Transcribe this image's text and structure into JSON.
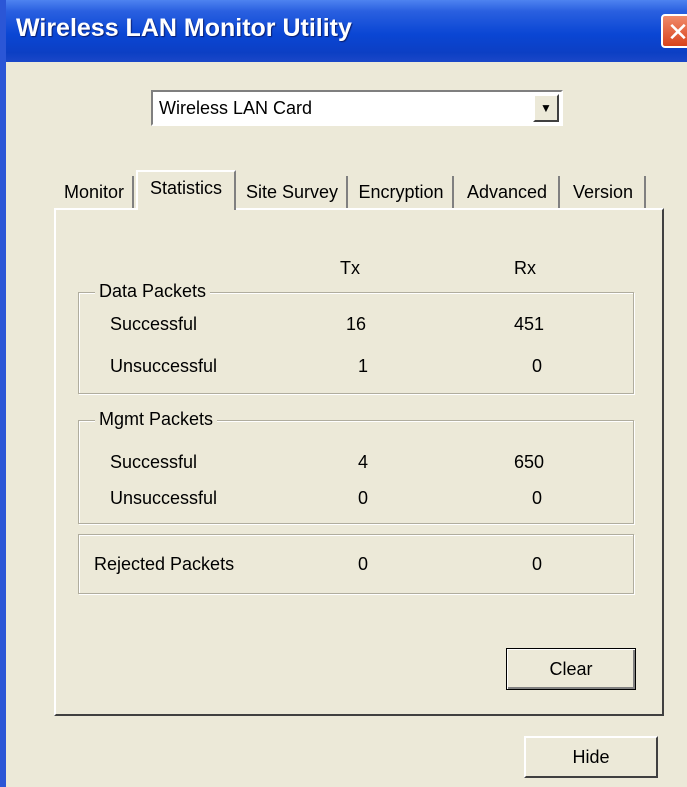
{
  "window": {
    "title": "Wireless LAN Monitor Utility",
    "close_glyph": "✕"
  },
  "card_select": {
    "value": "Wireless LAN Card",
    "arrow_glyph": "▼"
  },
  "tabs": [
    {
      "label": "Monitor"
    },
    {
      "label": "Statistics",
      "active": true
    },
    {
      "label": "Site Survey"
    },
    {
      "label": "Encryption"
    },
    {
      "label": "Advanced"
    },
    {
      "label": "Version"
    }
  ],
  "columns": {
    "tx": "Tx",
    "rx": "Rx"
  },
  "data_packets": {
    "title": "Data Packets",
    "rows": [
      {
        "label": "Successful",
        "tx": "16",
        "rx": "451"
      },
      {
        "label": "Unsuccessful",
        "tx": "1",
        "rx": "0"
      }
    ]
  },
  "mgmt_packets": {
    "title": "Mgmt Packets",
    "rows": [
      {
        "label": "Successful",
        "tx": "4",
        "rx": "650"
      },
      {
        "label": "Unsuccessful",
        "tx": "0",
        "rx": "0"
      }
    ]
  },
  "rejected_packets": {
    "label": "Rejected Packets",
    "tx": "0",
    "rx": "0"
  },
  "buttons": {
    "clear": "Clear",
    "hide": "Hide"
  },
  "colors": {
    "titlebar": "#0a46d4",
    "dialog_bg": "#ece9d8",
    "close_button": "#d8431c"
  }
}
